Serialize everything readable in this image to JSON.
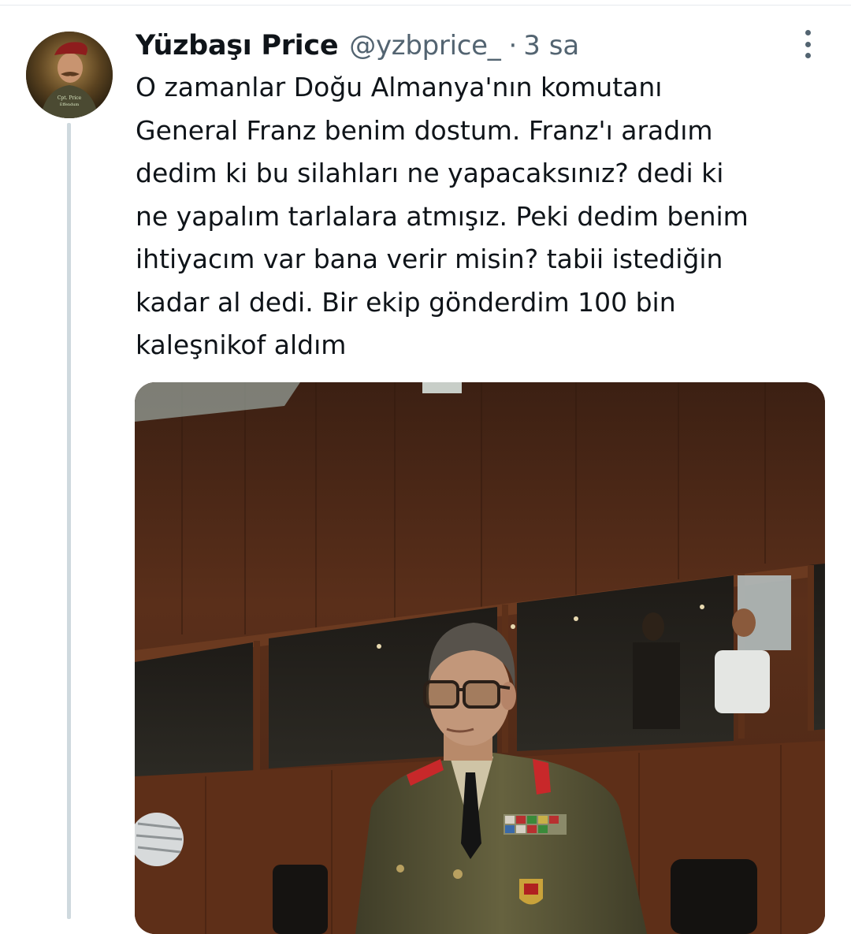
{
  "tweet": {
    "author": {
      "display_name": "Yüzbaşı Price",
      "handle": "@yzbprice_",
      "avatar_caption_lines": [
        "Cpt. Price",
        "Effendum"
      ]
    },
    "separator": "·",
    "timestamp": "3 sa",
    "text_lines": [
      "O zamanlar Doğu Almanya'nın komutanı",
      "General Franz benim dostum. Franz'ı aradım",
      "dedim ki bu silahları ne yapacaksınız? dedi ki",
      "ne yapalım tarlalara atmışız. Peki dedim benim",
      "ihtiyacım var bana verir misin? tabii istediğin",
      "kadar al dedi. Bir ekip gönderdim 100 bin",
      "kaleşnikof aldım"
    ],
    "media": {
      "description": "photo",
      "colors": {
        "wood_paneling": "#4a2817",
        "uniform": "#5d5a3c",
        "collar_tabs": "#c8282a"
      }
    }
  },
  "icons": {
    "more": "more-options-icon"
  },
  "colors": {
    "primary_text": "#0f1419",
    "secondary_text": "#536471",
    "thread_line": "#cfd9de"
  }
}
